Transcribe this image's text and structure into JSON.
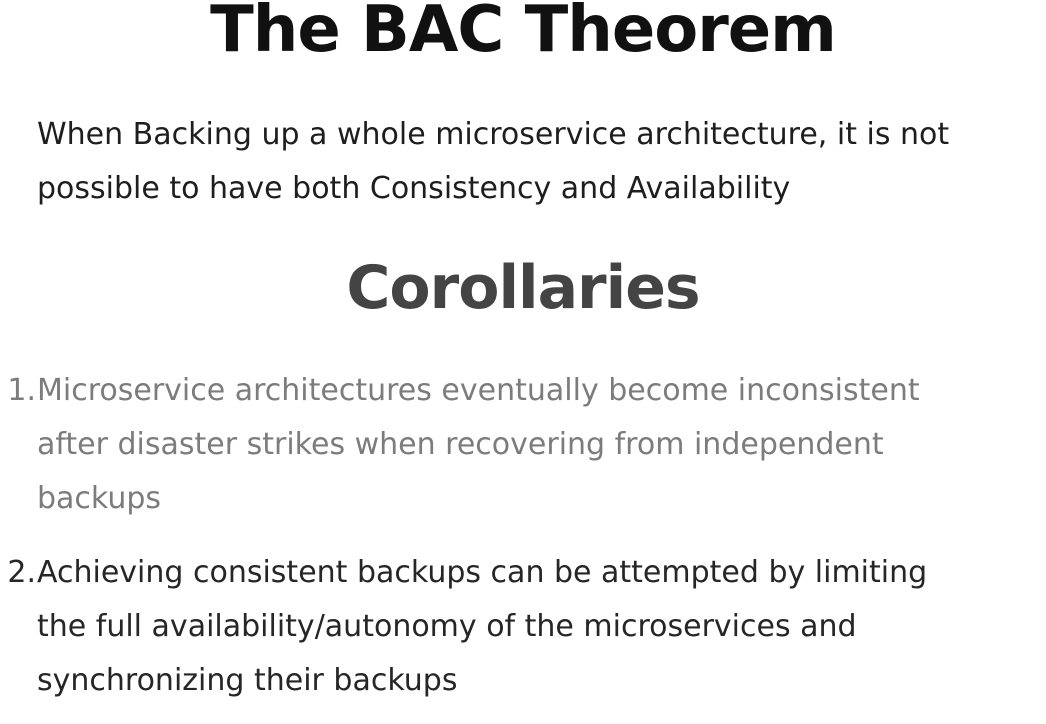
{
  "slide": {
    "title": "The BAC Theorem",
    "theorem_lines": [
      "When Backing up a whole microservice architecture, it is not",
      "possible to have both Consistency and Availability"
    ],
    "subtitle": "Corollaries",
    "corollaries": [
      {
        "number": "1.",
        "lines": [
          "Microservice architectures eventually become inconsistent",
          "after disaster strikes when recovering from independent",
          "backups"
        ]
      },
      {
        "number": "2.",
        "lines": [
          "Achieving consistent backups can be attempted by limiting",
          "the full availability/autonomy of the microservices and",
          "synchronizing their backups"
        ]
      }
    ]
  },
  "colors": {
    "title": "#111111",
    "body_text": "#1e1e1e",
    "subtitle": "#444444",
    "corollary_dimmed": "#7c7c7c",
    "corollary_active": "#262626",
    "background": "#ffffff"
  }
}
